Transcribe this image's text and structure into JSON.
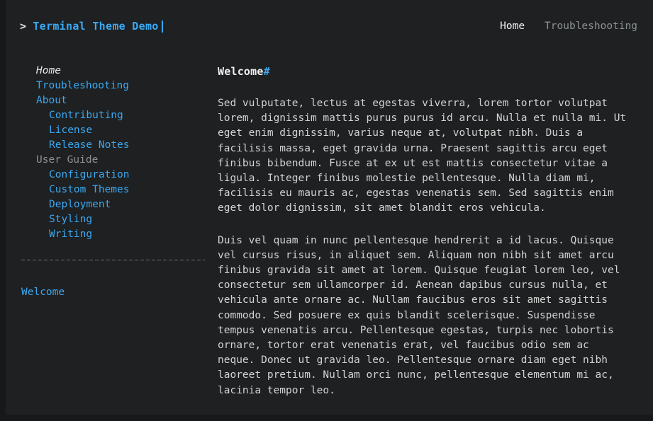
{
  "header": {
    "prompt": ">",
    "site_title": "Terminal Theme Demo",
    "nav": [
      {
        "label": "Home",
        "state": "active"
      },
      {
        "label": "Troubleshooting",
        "state": "link"
      }
    ]
  },
  "sidebar": {
    "items": [
      {
        "label": "Home",
        "level": 0,
        "kind": "current"
      },
      {
        "label": "Troubleshooting",
        "level": 0,
        "kind": "link"
      },
      {
        "label": "About",
        "level": 0,
        "kind": "link"
      },
      {
        "label": "Contributing",
        "level": 1,
        "kind": "link"
      },
      {
        "label": "License",
        "level": 1,
        "kind": "link"
      },
      {
        "label": "Release Notes",
        "level": 1,
        "kind": "link"
      },
      {
        "label": "User Guide",
        "level": 0,
        "kind": "section"
      },
      {
        "label": "Configuration",
        "level": 1,
        "kind": "link"
      },
      {
        "label": "Custom Themes",
        "level": 1,
        "kind": "link"
      },
      {
        "label": "Deployment",
        "level": 1,
        "kind": "link"
      },
      {
        "label": "Styling",
        "level": 1,
        "kind": "link"
      },
      {
        "label": "Writing",
        "level": 1,
        "kind": "link"
      }
    ],
    "toc": [
      {
        "label": "Welcome"
      }
    ]
  },
  "main": {
    "heading": "Welcome",
    "heading_anchor": "#",
    "paragraphs": [
      "Sed vulputate, lectus at egestas viverra, lorem tortor volutpat lorem, dignissim mattis purus purus id arcu. Nulla et nulla mi. Ut eget enim dignissim, varius neque at, volutpat nibh. Duis a facilisis massa, eget gravida urna. Praesent sagittis arcu eget finibus bibendum. Fusce at ex ut est mattis consectetur vitae a ligula. Integer finibus molestie pellentesque. Nulla diam mi, facilisis eu mauris ac, egestas venenatis sem. Sed sagittis enim eget dolor dignissim, sit amet blandit eros vehicula.",
      "Duis vel quam in nunc pellentesque hendrerit a id lacus. Quisque vel cursus risus, in aliquet sem. Aliquam non nibh sit amet arcu finibus gravida sit amet at lorem. Quisque feugiat lorem leo, vel consectetur sem ullamcorper id. Aenean dapibus cursus nulla, et vehicula ante ornare ac. Nullam faucibus eros sit amet sagittis commodo. Sed posuere ex quis blandit scelerisque. Suspendisse tempus venenatis arcu. Pellentesque egestas, turpis nec lobortis ornare, tortor erat venenatis erat, vel faucibus odio sem ac neque. Donec ut gravida leo. Pellentesque ornare diam eget nibh laoreet pretium. Nullam orci nunc, pellentesque elementum mi ac, lacinia tempor leo."
    ]
  },
  "theme": {
    "background": "#1e2021",
    "frame": "#161819",
    "accent": "#3ba8f2",
    "text": "#d3d3d3",
    "muted": "#8c9194"
  }
}
